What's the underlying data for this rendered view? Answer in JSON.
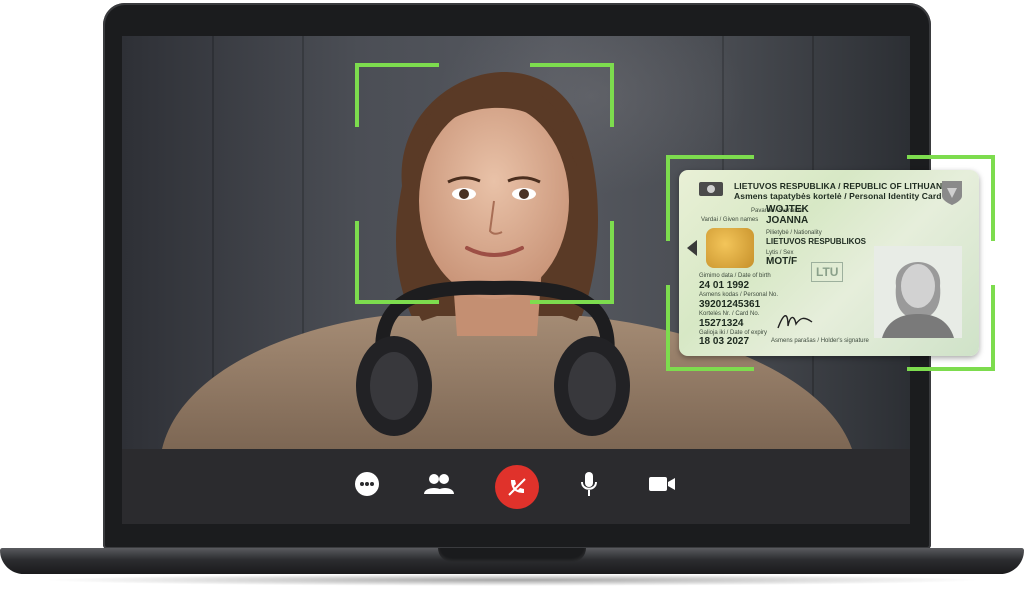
{
  "id_card": {
    "header_line1": "LIETUVOS RESPUBLIKA / REPUBLIC OF LITHUANIA",
    "header_line2": "Asmens tapatybės kortelė / Personal Identity Card",
    "surname_label": "Pavardė / Surname",
    "surname": "WOJTEK",
    "given_label": "Vardai / Given names",
    "given": "JOANNA",
    "nationality_label": "Pilietybė / Nationality",
    "nationality": "LIETUVOS RESPUBLIKOS",
    "sex_label": "Lytis / Sex",
    "sex": "MOT/F",
    "dob_label": "Gimimo data / Date of birth",
    "dob": "24 01 1992",
    "personal_no_label": "Asmens kodas / Personal No.",
    "personal_no": "39201245361",
    "card_no_label": "Kortelės Nr. / Card No.",
    "card_no": "15271324",
    "expiry_label": "Galioja iki / Date of expiry",
    "expiry": "18 03 2027",
    "signature_label": "Asmens parašas / Holder's signature",
    "country_code": "LTU"
  },
  "toolbar": {
    "buttons": [
      "more-options",
      "participants",
      "end-call",
      "microphone",
      "camera"
    ]
  },
  "colors": {
    "frame": "#7ddc4e",
    "end_call": "#e0322b",
    "toolbar_bg": "#2b2b2e"
  }
}
